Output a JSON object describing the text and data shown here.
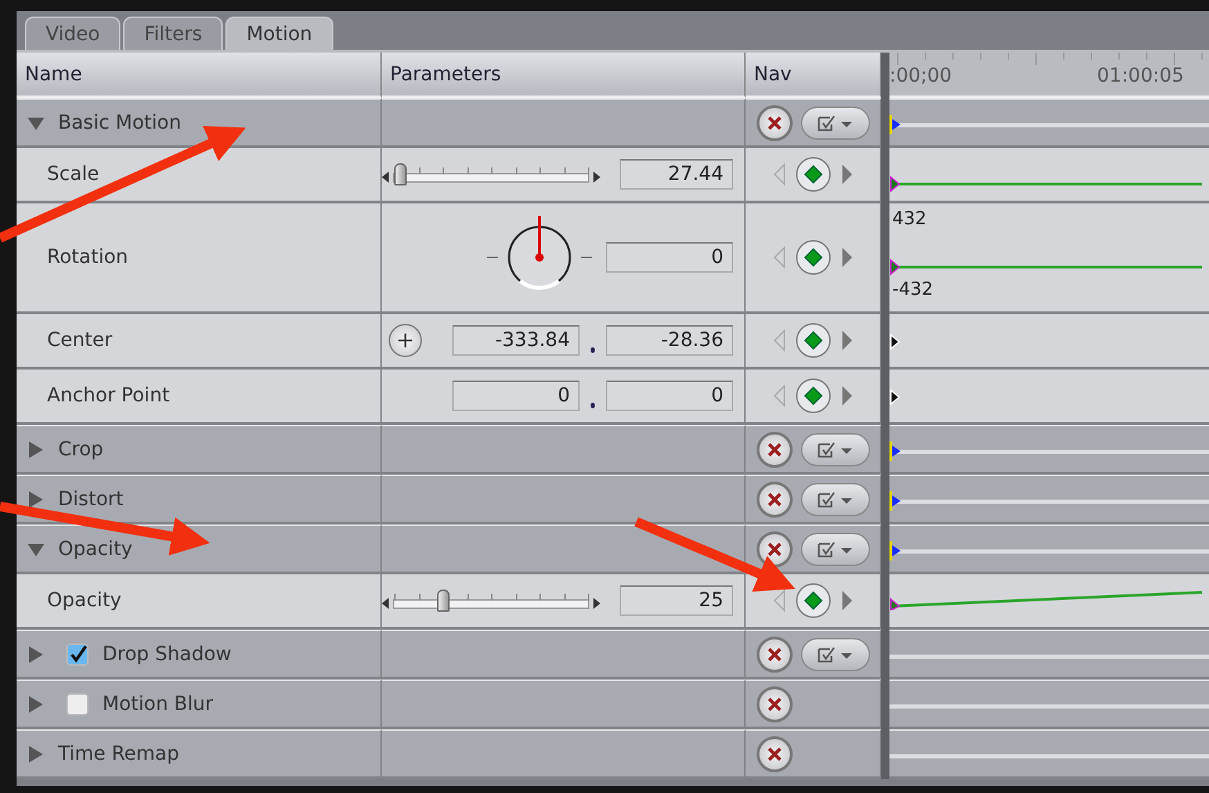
{
  "tabs": [
    {
      "label": "Video",
      "selected": false
    },
    {
      "label": "Filters",
      "selected": false
    },
    {
      "label": "Motion",
      "selected": true
    }
  ],
  "columns": [
    "Name",
    "Parameters",
    "Nav"
  ],
  "ruler": [
    ":00;00",
    "01:00:05"
  ],
  "rows": [
    {
      "kind": "group",
      "name": "Basic Motion",
      "expanded": true,
      "has_menu": true,
      "marker": true
    },
    {
      "kind": "slider",
      "name": "Scale",
      "level": 0.03,
      "value": "27.44",
      "keyframed": true,
      "animated": false
    },
    {
      "kind": "dial",
      "name": "Rotation",
      "value": "0",
      "keyframed": true,
      "animated": false,
      "graph_max": "432",
      "graph_min": "-432"
    },
    {
      "kind": "point",
      "name": "Center",
      "values": [
        "-333.84",
        "-28.36"
      ],
      "crosshair": true,
      "keyframed": false
    },
    {
      "kind": "point",
      "name": "Anchor Point",
      "values": [
        "0",
        "0"
      ],
      "crosshair": false,
      "keyframed": false
    },
    {
      "kind": "group",
      "name": "Crop",
      "expanded": false,
      "has_menu": true,
      "marker": true
    },
    {
      "kind": "group",
      "name": "Distort",
      "expanded": false,
      "has_menu": true,
      "marker": true
    },
    {
      "kind": "group",
      "name": "Opacity",
      "expanded": true,
      "has_menu": true,
      "marker": true
    },
    {
      "kind": "slider",
      "name": "Opacity",
      "level": 0.25,
      "value": "25",
      "keyframed": true,
      "animated": true
    },
    {
      "kind": "group",
      "name": "Drop Shadow",
      "expanded": false,
      "checked": true,
      "has_menu": true,
      "marker": false
    },
    {
      "kind": "group",
      "name": "Motion Blur",
      "expanded": false,
      "checked": false,
      "has_menu": false,
      "marker": false
    },
    {
      "kind": "group",
      "name": "Time Remap",
      "expanded": false,
      "has_menu": false,
      "marker": false
    }
  ]
}
